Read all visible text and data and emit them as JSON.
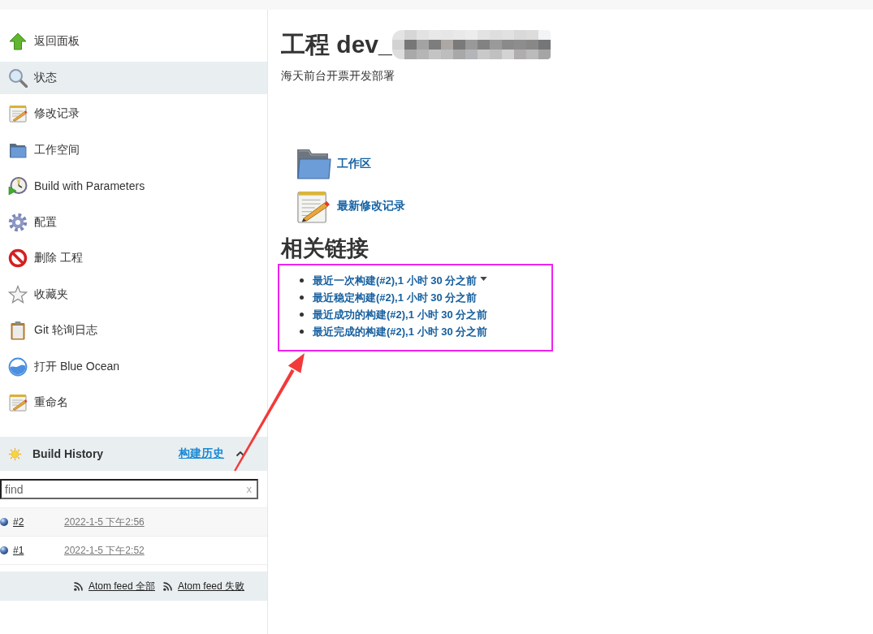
{
  "sidebar": {
    "items": [
      {
        "label": "返回面板",
        "selected": false
      },
      {
        "label": "状态",
        "selected": true
      },
      {
        "label": "修改记录",
        "selected": false
      },
      {
        "label": "工作空间",
        "selected": false
      },
      {
        "label": "Build with Parameters",
        "selected": false
      },
      {
        "label": "配置",
        "selected": false
      },
      {
        "label": "删除 工程",
        "selected": false
      },
      {
        "label": "收藏夹",
        "selected": false
      },
      {
        "label": "Git 轮询日志",
        "selected": false
      },
      {
        "label": "打开 Blue Ocean",
        "selected": false
      },
      {
        "label": "重命名",
        "selected": false
      }
    ]
  },
  "build_history": {
    "title": "Build History",
    "link": "构建历史",
    "expanded": true,
    "search": {
      "placeholder": "find",
      "clear": "x"
    },
    "builds": [
      {
        "number": "#2",
        "time": "2022-1-5 下午2:56"
      },
      {
        "number": "#1",
        "time": "2022-1-5 下午2:52"
      }
    ],
    "feeds": [
      "Atom feed 全部",
      "Atom feed 失败"
    ]
  },
  "main": {
    "title": "工程 dev_",
    "description": "海天前台开票开发部署",
    "actions": [
      "工作区",
      "最新修改记录"
    ],
    "related_links": {
      "title": "相关链接",
      "links": [
        {
          "label": "最近一次构建(#2),1 小时 30 分之前",
          "menu": true
        },
        {
          "label": "最近稳定构建(#2),1 小时 30 分之前",
          "menu": false
        },
        {
          "label": "最近成功的构建(#2),1 小时 30 分之前",
          "menu": false
        },
        {
          "label": "最近完成的构建(#2),1 小时 30 分之前",
          "menu": false
        }
      ]
    }
  }
}
